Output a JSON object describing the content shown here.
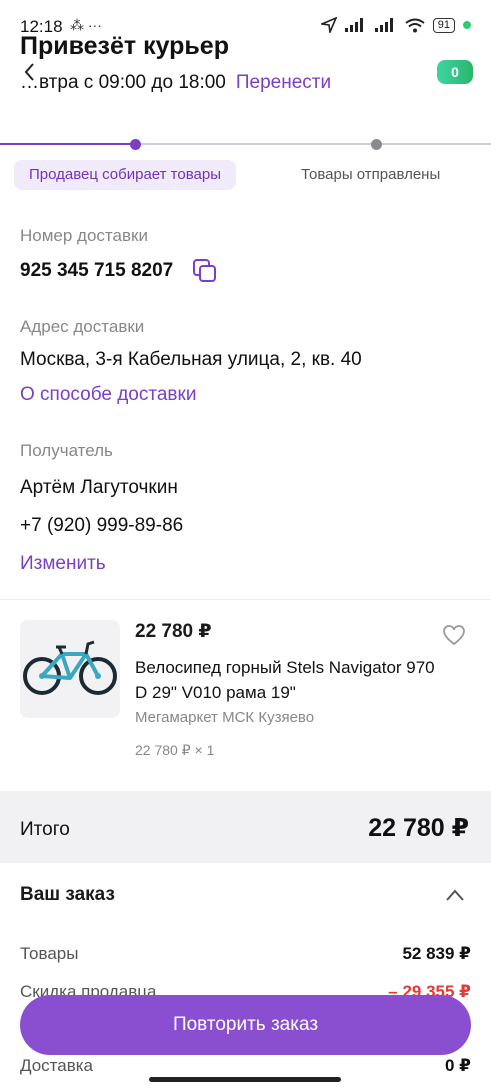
{
  "status_bar": {
    "time": "12:18",
    "extra": "⁂ ···",
    "battery": "91"
  },
  "header": {
    "title": "Привезёт курьер",
    "badge": "0"
  },
  "delivery": {
    "when": "…втра с 09:00 до 18:00",
    "reschedule": "Перенести"
  },
  "steps": {
    "active": "Продавец собирает товары",
    "next": "Товары отправлены"
  },
  "tracking": {
    "label": "Номер доставки",
    "number": "925 345 715 8207"
  },
  "address": {
    "label": "Адрес доставки",
    "value": "Москва, 3-я Кабельная улица, 2, кв. 40",
    "link": "О способе доставки"
  },
  "recipient": {
    "label": "Получатель",
    "name": "Артём Лагуточкин",
    "phone": "+7 (920) 999-89-86",
    "edit": "Изменить"
  },
  "product": {
    "price": "22 780 ₽",
    "name": "Велосипед горный Stels Navigator 970 D 29\" V010 рама 19\"",
    "seller": "Мегамаркет МСК Кузяево",
    "qty": "22 780 ₽ × 1"
  },
  "total": {
    "label": "Итого",
    "value": "22 780 ₽"
  },
  "order": {
    "title": "Ваш заказ",
    "rows": [
      {
        "label": "Товары",
        "value": "52 839 ₽"
      },
      {
        "label": "Скидка продавца",
        "value": "– 29 355 ₽"
      },
      {
        "label": "Доставка",
        "value": "0 ₽"
      }
    ]
  },
  "actions": {
    "repeat": "Повторить заказ"
  },
  "colors": {
    "accent": "#7a3fc4",
    "button": "#8a4fd1",
    "discount": "#e03a3a"
  }
}
